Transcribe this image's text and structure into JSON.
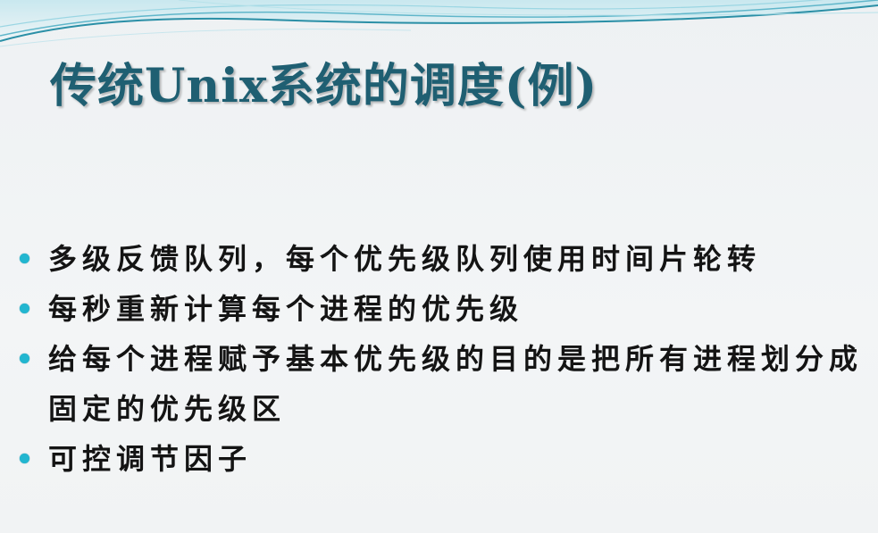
{
  "slide": {
    "title": "传统Unix系统的调度(例)",
    "bullets": [
      "多级反馈队列，每个优先级队列使用时间片轮转",
      "每秒重新计算每个进程的优先级",
      "给每个进程赋予基本优先级的目的是把所有进程划分成固定的优先级区",
      "可控调节因子"
    ]
  },
  "colors": {
    "title": "#1f5f72",
    "bullet": "#22b6d0",
    "text": "#141414",
    "background": "#f1f3f5",
    "wave_dark": "#2a8fa6",
    "wave_light": "#9bd6e3"
  }
}
